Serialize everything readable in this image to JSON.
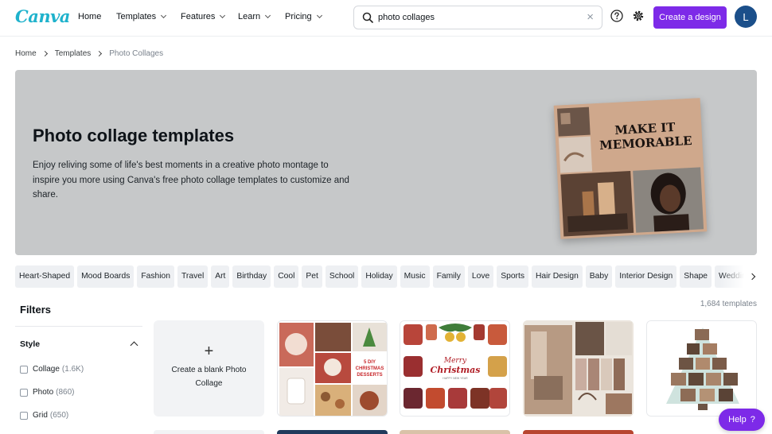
{
  "nav": {
    "logo": "Canva",
    "items": [
      "Home",
      "Templates",
      "Features",
      "Learn",
      "Pricing"
    ],
    "search_value": "photo collages",
    "clear_glyph": "×",
    "help_icon": "question-circle-icon",
    "settings_icon": "gear-icon",
    "cta_label": "Create a design",
    "avatar_initial": "L",
    "brand_color": "#7d2ae8"
  },
  "breadcrumb": [
    "Home",
    "Templates",
    "Photo Collages"
  ],
  "hero": {
    "title": "Photo collage templates",
    "description": "Enjoy reliving some of life's best moments in a creative photo montage to inspire you more using Canva's free photo collage templates to customize and share.",
    "image_text": "MAKE IT MEMORABLE"
  },
  "categories": [
    "Heart-Shaped",
    "Mood Boards",
    "Fashion",
    "Travel",
    "Art",
    "Birthday",
    "Cool",
    "Pet",
    "School",
    "Holiday",
    "Music",
    "Family",
    "Love",
    "Sports",
    "Hair Design",
    "Baby",
    "Interior Design",
    "Shape",
    "Wedding"
  ],
  "filters": {
    "title": "Filters",
    "style_label": "Style",
    "options": [
      {
        "label": "Collage",
        "count": "(1.6K)"
      },
      {
        "label": "Photo",
        "count": "(860)"
      },
      {
        "label": "Grid",
        "count": "(650)"
      }
    ]
  },
  "results": {
    "count_label": "1,684 templates",
    "blank_tile": {
      "plus": "+",
      "label": "Create a blank Photo Collage"
    },
    "template_texts": {
      "desserts": "5 DIY CHRISTMAS DESSERTS",
      "merry": "Merry",
      "christmas": "Christmas",
      "merry_sub": "HAPPY NEW YEAR"
    }
  },
  "help": {
    "label": "Help",
    "glyph": "?"
  }
}
